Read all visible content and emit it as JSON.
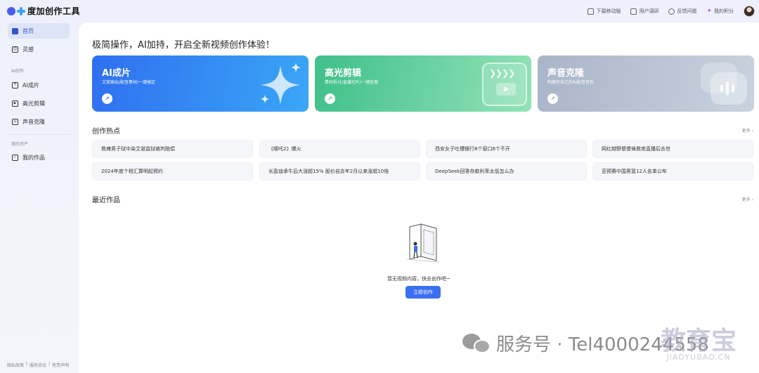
{
  "app": {
    "title": "度加创作工具"
  },
  "top_actions": [
    {
      "label": "下载移动版",
      "icon": "download-icon"
    },
    {
      "label": "用户调研",
      "icon": "survey-icon"
    },
    {
      "label": "反馈问题",
      "icon": "feedback-icon"
    },
    {
      "label": "我的积分",
      "icon": "points-icon"
    }
  ],
  "sidebar": {
    "home": "首页",
    "inspiration": "灵感",
    "ai_section": "AI创作",
    "ai_video": "AI成片",
    "highlight": "高光剪辑",
    "voice_clone": "声音克隆",
    "assets_section": "我的资产",
    "my_works": "我的作品",
    "footer": [
      "隐私政策",
      "服务协议",
      "免责声明"
    ]
  },
  "main": {
    "headline": "极简操作，AI加持，开启全新视频创作体验！",
    "cards": [
      {
        "title": "AI成片",
        "subtitle": "文案输出/配音素材/一键搞定"
      },
      {
        "title": "高光剪辑",
        "subtitle": "素材拆分/直播切片/一键处理"
      },
      {
        "title": "声音克隆",
        "subtitle": "构建你自己的AI配音音色"
      }
    ],
    "hot_title": "创作热点",
    "more": "更多",
    "hot_topics": [
      "救瘫男子狱中染艾滋监狱被判赔偿",
      "《哪吒2》爆火",
      "西安女子吐槽银行8个窗口6个不开",
      "网红越野傻傻候救夜直播后去世",
      "2024年度个税汇算明起预约",
      "长盈迪承牛后大涨超15% 股价自去年2月以来涨超10倍",
      "DeepSeek回答存款利率太低怎么办",
      "亚预赛中国男篮12人名单公布"
    ],
    "recent_title": "最近作品",
    "empty_text": "暂无视频内容，快去创作吧~",
    "create_button": "立即创作"
  },
  "watermark": {
    "text": "服务号 · Tel4000244558",
    "brand": "教育宝",
    "brand_url": "JIAOYUBAO.CN"
  },
  "colors": {
    "accent": "#3a6ff0",
    "card_blue": "#2f6ff0",
    "card_green": "#3fc08a",
    "card_gray": "#a9b5c8"
  }
}
